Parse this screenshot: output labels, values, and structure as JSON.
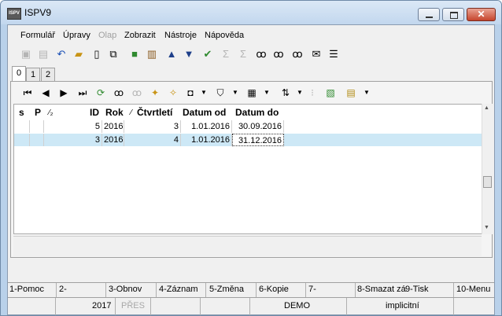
{
  "window": {
    "title": "ISPV9",
    "app_icon_text": "ISPV"
  },
  "menu": [
    "Formulář",
    "Úpravy",
    "Olap",
    "Zobrazit",
    "Nástroje",
    "Nápověda"
  ],
  "tabs": [
    "0",
    "1",
    "2"
  ],
  "grid": {
    "headers": {
      "s": "s",
      "p": "P",
      "sort": "⁄₂",
      "id": "ID",
      "rok": "Rok",
      "ctvrt_sort": "⁄",
      "ctvrtleti": "Čtvrtletí",
      "datum_od": "Datum od",
      "datum_do": "Datum do"
    },
    "rows": [
      {
        "id": "5",
        "rok": "2016",
        "ctvrtleti": "3",
        "datum_od": "1.01.2016",
        "datum_do": "30.09.2016",
        "selected": false
      },
      {
        "id": "3",
        "rok": "2016",
        "ctvrtleti": "4",
        "datum_od": "1.01.2016",
        "datum_do": "31.12.2016",
        "selected": true
      }
    ]
  },
  "fkeys": [
    "1-Pomoc",
    "2-",
    "3-Obnov",
    "4-Záznam",
    "5-Změna",
    "6-Kopie",
    "7-",
    "8-Smazat zá",
    "9-Tisk",
    "10-Menu"
  ],
  "status": {
    "year": "2017",
    "mode": "PŘES",
    "db": "DEMO",
    "profile": "implicitní"
  },
  "colors": {
    "selected_row": "#cde8f6",
    "title_bg": "#c2d7ee",
    "close_btn": "#c6452c"
  }
}
